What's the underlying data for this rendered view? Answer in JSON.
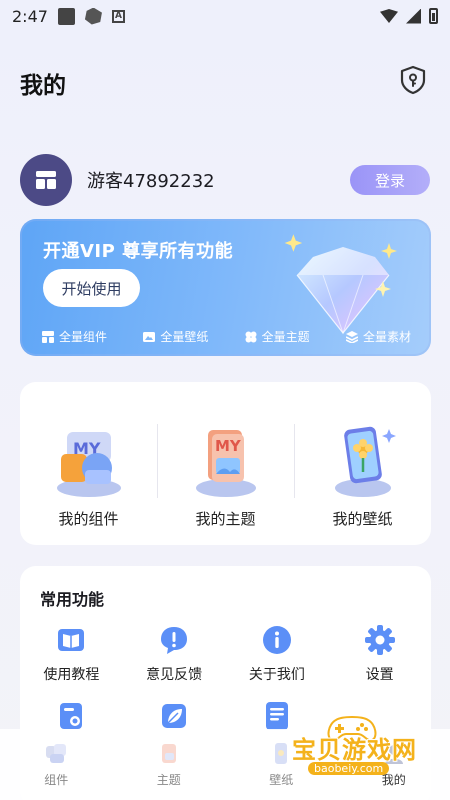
{
  "status_bar": {
    "time": "2:47"
  },
  "header": {
    "title": "我的"
  },
  "profile": {
    "username": "游客47892232",
    "login_label": "登录"
  },
  "vip": {
    "title": "开通VIP 尊享所有功能",
    "start_label": "开始使用",
    "features": [
      "全量组件",
      "全量壁纸",
      "全量主题",
      "全量素材"
    ]
  },
  "assets": {
    "items": [
      {
        "label": "我的组件",
        "badge": "MY"
      },
      {
        "label": "我的主题",
        "badge": "MY"
      },
      {
        "label": "我的壁纸"
      }
    ]
  },
  "functions": {
    "title": "常用功能",
    "items": [
      {
        "label": "使用教程",
        "icon": "book-icon"
      },
      {
        "label": "意见反馈",
        "icon": "feedback-icon"
      },
      {
        "label": "关于我们",
        "icon": "info-icon"
      },
      {
        "label": "设置",
        "icon": "gear-icon"
      },
      {
        "label": "",
        "icon": "screen-icon"
      },
      {
        "label": "",
        "icon": "leaf-icon"
      },
      {
        "label": "",
        "icon": "document-icon"
      }
    ]
  },
  "tabs": [
    {
      "label": "组件"
    },
    {
      "label": "主题"
    },
    {
      "label": "壁纸"
    },
    {
      "label": "我的"
    }
  ],
  "watermark": {
    "text": "宝贝游戏网",
    "url": "baobeiy.com"
  },
  "colors": {
    "accent": "#9a94f7",
    "vip_blue": "#5ea5f6",
    "avatar": "#4c4a86",
    "watermark": "#f4b21b"
  }
}
